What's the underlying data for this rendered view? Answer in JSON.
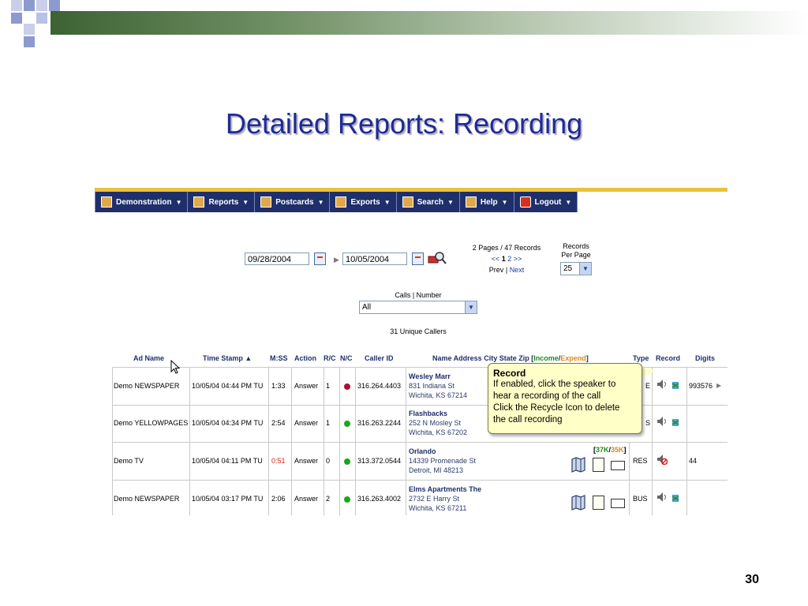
{
  "slide": {
    "title": "Detailed Reports:  Recording",
    "page_number": "30"
  },
  "colors": {
    "title": "#1f2a99",
    "menubar": "#1f2f6b",
    "accent_line": "#e8c23a",
    "dot_red": "#b01030",
    "dot_green": "#1ea51e"
  },
  "menu": [
    {
      "label": "Demonstration",
      "icon": "building-icon"
    },
    {
      "label": "Reports",
      "icon": "report-icon"
    },
    {
      "label": "Postcards",
      "icon": "postcard-icon"
    },
    {
      "label": "Exports",
      "icon": "export-icon"
    },
    {
      "label": "Search",
      "icon": "search-icon"
    },
    {
      "label": "Help",
      "icon": "help-icon"
    },
    {
      "label": "Logout",
      "icon": "logout-icon"
    }
  ],
  "filters": {
    "start_date": "09/28/2004",
    "end_date": "10/05/2004",
    "pages_info": "2 Pages / 47 Records",
    "pager_prev": "<<",
    "pager_current": "1",
    "pager_other": "2",
    "pager_next_sym": ">>",
    "prev_label": "Prev",
    "pipe": "|",
    "next_label": "Next",
    "records_label_1": "Records",
    "records_label_2": "Per Page",
    "per_page": "25",
    "calls_label": "Calls | Number",
    "calls_value": "All",
    "unique_callers": "31 Unique Callers"
  },
  "columns": {
    "ad_name": "Ad Name",
    "time_stamp": "Time Stamp",
    "mss": "M:SS",
    "action": "Action",
    "rc": "R/C",
    "nc": "N/C",
    "caller_id": "Caller ID",
    "name_address_pre": "Name Address City State Zip [",
    "income": "Income",
    "slash": "/",
    "expend": "Expend",
    "close_bracket": "]",
    "type": "Type",
    "record": "Record",
    "digits": "Digits"
  },
  "rows": [
    {
      "ad": "Demo NEWSPAPER",
      "time": "10/05/04 04:44 PM TU",
      "mss": "1:33",
      "mss_red": false,
      "action": "Answer",
      "rc": "1",
      "nc_color": "#b01030",
      "caller": "316.264.4403",
      "name": "Wesley Marr",
      "street": "831 Indiana St",
      "city": "Wichita, KS 67214",
      "type": "",
      "digits": "993576",
      "recycle": true
    },
    {
      "ad": "Demo YELLOWPAGES",
      "time": "10/05/04 04:34 PM TU",
      "mss": "2:54",
      "mss_red": false,
      "action": "Answer",
      "rc": "1",
      "nc_color": "#1ea51e",
      "caller": "316.263.2244",
      "name": "Flashbacks",
      "street": "252 N Mosley St",
      "city": "Wichita, KS 67202",
      "type": "",
      "digits": "",
      "recycle": true
    },
    {
      "ad": "Demo TV",
      "time": "10/05/04 04:11 PM TU",
      "mss": "0:51",
      "mss_red": true,
      "action": "Answer",
      "rc": "0",
      "nc_color": "#1ea51e",
      "caller": "313.372.0544",
      "name": "Orlando",
      "street": "14339 Promenade St",
      "city": "Detroit, MI 48213",
      "type": "RES",
      "digits": "44",
      "recycle": false,
      "income": "37K",
      "expend": "35K"
    },
    {
      "ad": "Demo NEWSPAPER",
      "time": "10/05/04 03:17 PM TU",
      "mss": "2:06",
      "mss_red": false,
      "action": "Answer",
      "rc": "2",
      "nc_color": "#1ea51e",
      "caller": "316.263.4002",
      "name": "Elms Apartments The",
      "street": "2732 E Harry St",
      "city": "Wichita, KS 67211",
      "type": "BUS",
      "digits": "",
      "recycle": true
    }
  ],
  "tooltip": {
    "title": "Record",
    "line1": "If enabled, click the speaker to",
    "line2": "hear a recording of the call",
    "line3": "Click the Recycle Icon to delete",
    "line4": "the call recording"
  },
  "row_fragments": {
    "row1_type": "E",
    "row2_type": "S",
    "row3_bracket_open": "[",
    "row3_bracket_close": "]"
  }
}
